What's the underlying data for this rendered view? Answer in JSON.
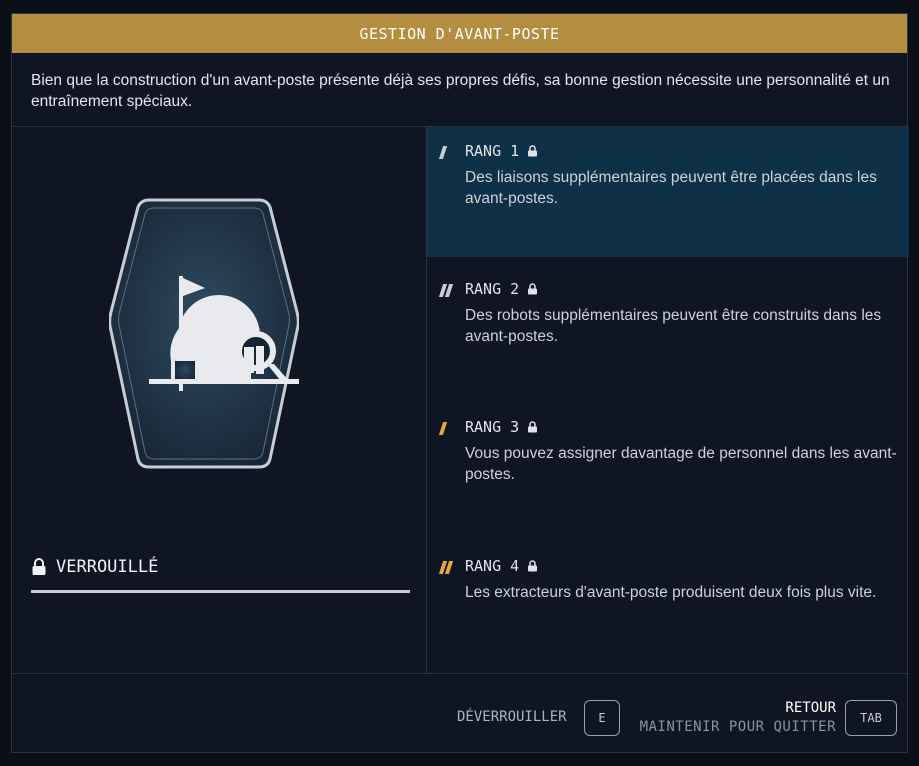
{
  "header": {
    "title": "GESTION D'AVANT-POSTE"
  },
  "description": "Bien que la construction d'un avant-poste présente déjà ses propres défis, sa bonne gestion nécessite une personnalité et un entraînement spéciaux.",
  "status": {
    "label": "VERROUILLÉ"
  },
  "ranks": [
    {
      "label": "RANG 1",
      "text": "Des liaisons supplémentaires peuvent être placées dans les avant-postes."
    },
    {
      "label": "RANG 2",
      "text": "Des robots supplémentaires peuvent être construits dans les avant-postes."
    },
    {
      "label": "RANG 3",
      "text": "Vous pouvez assigner davantage de personnel dans les avant-postes."
    },
    {
      "label": "RANG 4",
      "text": "Les extracteurs d'avant-poste produisent deux fois plus vite."
    }
  ],
  "footer": {
    "unlock_label": "DÉVERROUILLER",
    "unlock_key": "E",
    "back_label": "RETOUR",
    "hold_label": "MAINTENIR POUR QUITTER",
    "back_key": "TAB"
  },
  "colors": {
    "accent": "#b38e40",
    "active_rank_bg": "#0f3147",
    "tier_white": "#c9ccd1",
    "tier_orange": "#e8a83a"
  },
  "icons": {
    "badge": "outpost-dome-flag-icon",
    "lock": "lock-icon"
  }
}
